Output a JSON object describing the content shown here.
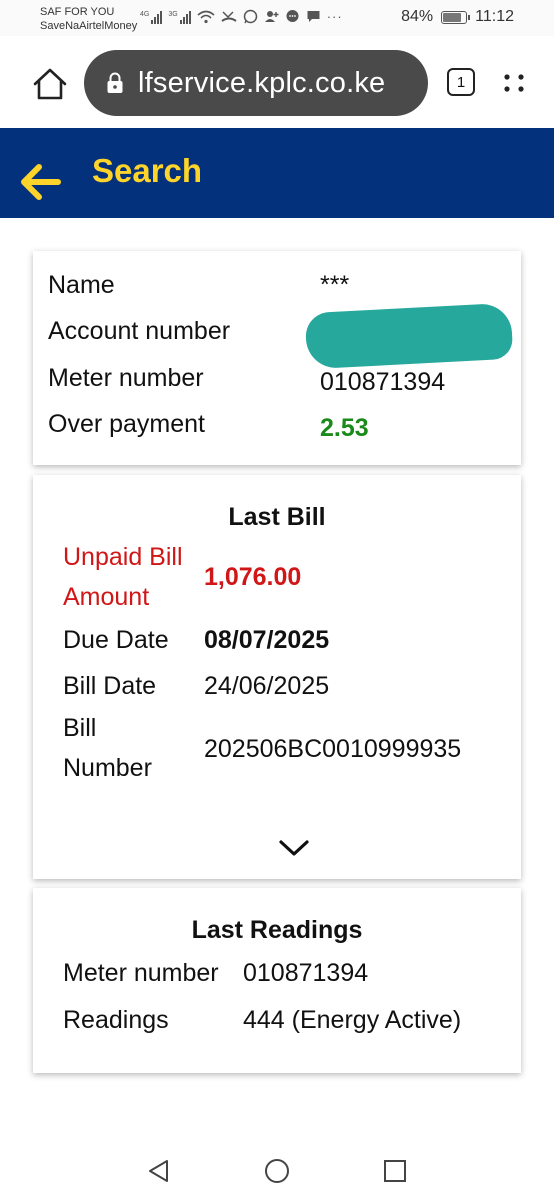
{
  "status_bar": {
    "carrier_line1": "SAF FOR YOU",
    "carrier_line2": "SaveNaAirtelMoney",
    "network1": "4G",
    "network2": "3G",
    "battery": "84%",
    "battery_level": 0.84,
    "time": "11:12"
  },
  "browser": {
    "url": "lfservice.kplc.co.ke",
    "tab_count": "1"
  },
  "header": {
    "title": "Search"
  },
  "account": {
    "rows": [
      {
        "label": "Name",
        "value": "***"
      },
      {
        "label": "Account number",
        "value": ""
      },
      {
        "label": "Meter number",
        "value": "010871394"
      },
      {
        "label": "Over payment",
        "value": "2.53"
      }
    ]
  },
  "last_bill": {
    "title": "Last Bill",
    "unpaid_label": "Unpaid Bill Amount",
    "unpaid_value": "1,076.00",
    "due_label": "Due Date",
    "due_value": "08/07/2025",
    "bill_date_label": "Bill Date",
    "bill_date_value": "24/06/2025",
    "bill_number_label": "Bill Number",
    "bill_number_value": "202506BC0010999935"
  },
  "last_readings": {
    "title": "Last Readings",
    "meter_label": "Meter number",
    "meter_value": "010871394",
    "readings_label": "Readings",
    "readings_value": "444 (Energy Active)"
  },
  "colors": {
    "header_bg": "#04317b",
    "header_accent": "#ffd42a",
    "overpayment": "#1a8a1a",
    "unpaid": "#d01616",
    "redaction": "#26a89c"
  }
}
